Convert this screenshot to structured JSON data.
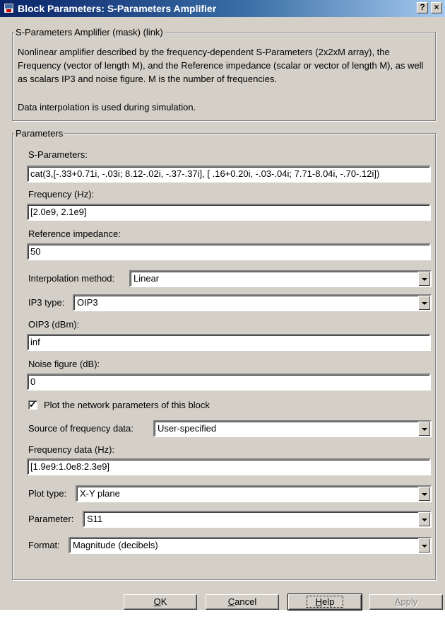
{
  "window": {
    "title": "Block Parameters: S-Parameters Amplifier",
    "help_glyph": "?",
    "close_glyph": "×"
  },
  "mask": {
    "legend": "S-Parameters Amplifier (mask) (link)",
    "description": "Nonlinear amplifier described by the frequency-dependent S-Parameters (2x2xM array), the Frequency (vector of length M), and the Reference impedance (scalar or vector of length M), as well as scalars IP3 and noise figure. M is the number of frequencies.",
    "note": "Data interpolation is used during simulation."
  },
  "parameters": {
    "legend": "Parameters",
    "sparams_label": "S-Parameters:",
    "sparams_value": "cat(3,[-.33+0.71i, -.03i;  8.12-.02i, -.37-.37i], [ .16+0.20i, -.03-.04i; 7.71-8.04i, -.70-.12i])",
    "freq_label": "Frequency (Hz):",
    "freq_value": "[2.0e9, 2.1e9]",
    "refimp_label": "Reference impedance:",
    "refimp_value": "50",
    "interp_label": "Interpolation method:",
    "interp_value": "Linear",
    "ip3type_label": "IP3 type:",
    "ip3type_value": "OIP3",
    "oip3_label": "OIP3 (dBm):",
    "oip3_value": "inf",
    "noise_label": "Noise figure (dB):",
    "noise_value": "0",
    "plot_check_label": "Plot the network parameters of this block",
    "plot_check_checked": true,
    "source_label": "Source of frequency data:",
    "source_value": "User-specified",
    "freqdata_label": "Frequency data (Hz):",
    "freqdata_value": "[1.9e9:1.0e8:2.3e9]",
    "plottype_label": "Plot type:",
    "plottype_value": "X-Y plane",
    "param_label": "Parameter:",
    "param_value": "S11",
    "format_label": "Format:",
    "format_value": "Magnitude (decibels)"
  },
  "buttons": {
    "ok_mnemonic": "O",
    "ok_rest": "K",
    "cancel_mnemonic": "C",
    "cancel_rest": "ancel",
    "help_mnemonic": "H",
    "help_rest": "elp",
    "apply_mnemonic": "A",
    "apply_rest": "pply"
  },
  "colors": {
    "face": "#d4d0c8",
    "title_start": "#0a246a",
    "title_end": "#a6caf0"
  }
}
